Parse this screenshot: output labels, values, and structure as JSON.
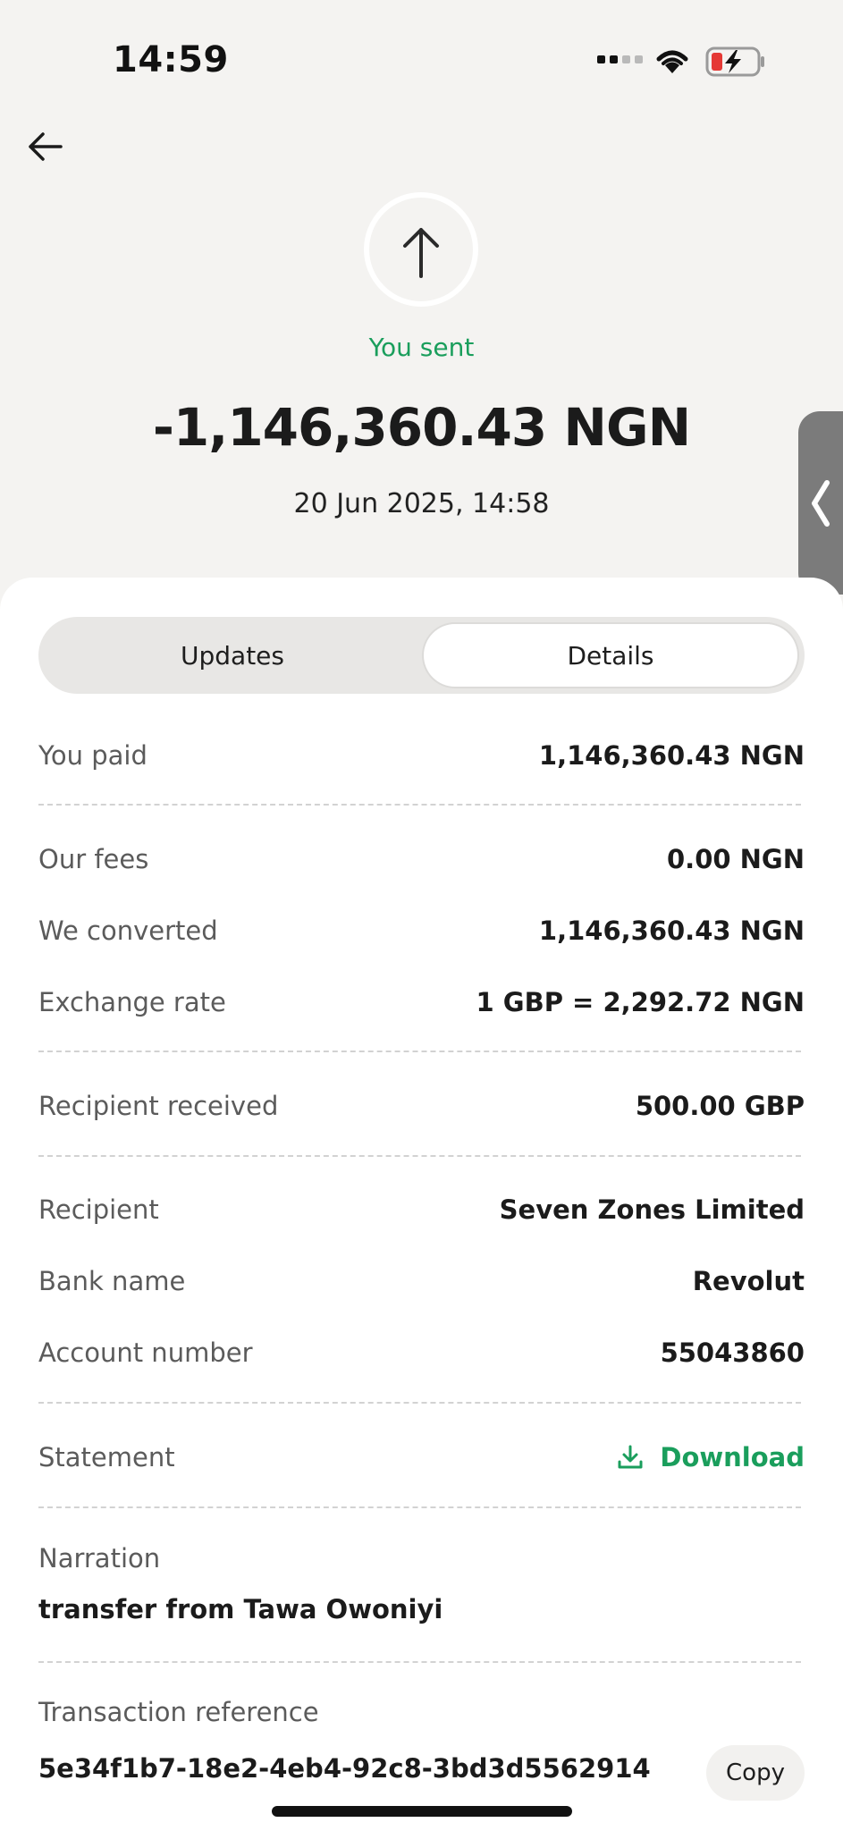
{
  "status_bar": {
    "time": "14:59",
    "wifi_icon": "wifi-icon",
    "battery_icon": "battery-charging-icon"
  },
  "header": {
    "back_icon": "arrow-left-icon"
  },
  "hero": {
    "icon": "arrow-up-icon",
    "label": "You sent",
    "amount": "-1,146,360.43 NGN",
    "date": "20 Jun 2025, 14:58",
    "accent_color": "#1a9e5c"
  },
  "tabs": [
    {
      "label": "Updates",
      "selected": false
    },
    {
      "label": "Details",
      "selected": true
    }
  ],
  "details": {
    "you_paid": {
      "label": "You paid",
      "value": "1,146,360.43 NGN"
    },
    "our_fees": {
      "label": "Our fees",
      "value": "0.00 NGN"
    },
    "we_converted": {
      "label": "We converted",
      "value": "1,146,360.43 NGN"
    },
    "exchange_rate": {
      "label": "Exchange rate",
      "value": "1 GBP = 2,292.72 NGN"
    },
    "recipient_received": {
      "label": "Recipient received",
      "value": "500.00 GBP"
    },
    "recipient": {
      "label": "Recipient",
      "value": "Seven Zones Limited"
    },
    "bank_name": {
      "label": "Bank name",
      "value": "Revolut"
    },
    "account_number": {
      "label": "Account number",
      "value": "55043860"
    },
    "statement": {
      "label": "Statement",
      "action_label": "Download",
      "icon": "download-icon"
    },
    "narration": {
      "label": "Narration",
      "value": "transfer from Tawa Owoniyi"
    },
    "transaction_reference": {
      "label": "Transaction reference",
      "value": "5e34f1b7-18e2-4eb4-92c8-3bd3d5562914",
      "copy_label": "Copy"
    }
  }
}
